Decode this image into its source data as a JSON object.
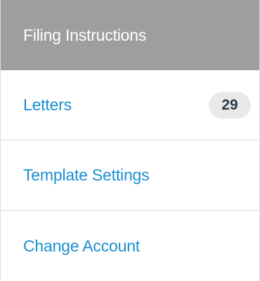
{
  "header": {
    "title": "Filing Instructions"
  },
  "menu": {
    "items": [
      {
        "label": "Letters",
        "badge": "29"
      },
      {
        "label": "Template Settings"
      },
      {
        "label": "Change Account"
      }
    ]
  },
  "colors": {
    "header_background": "#9e9e9e",
    "link_text": "#1a8fd0",
    "badge_background": "#e9e9e9"
  }
}
